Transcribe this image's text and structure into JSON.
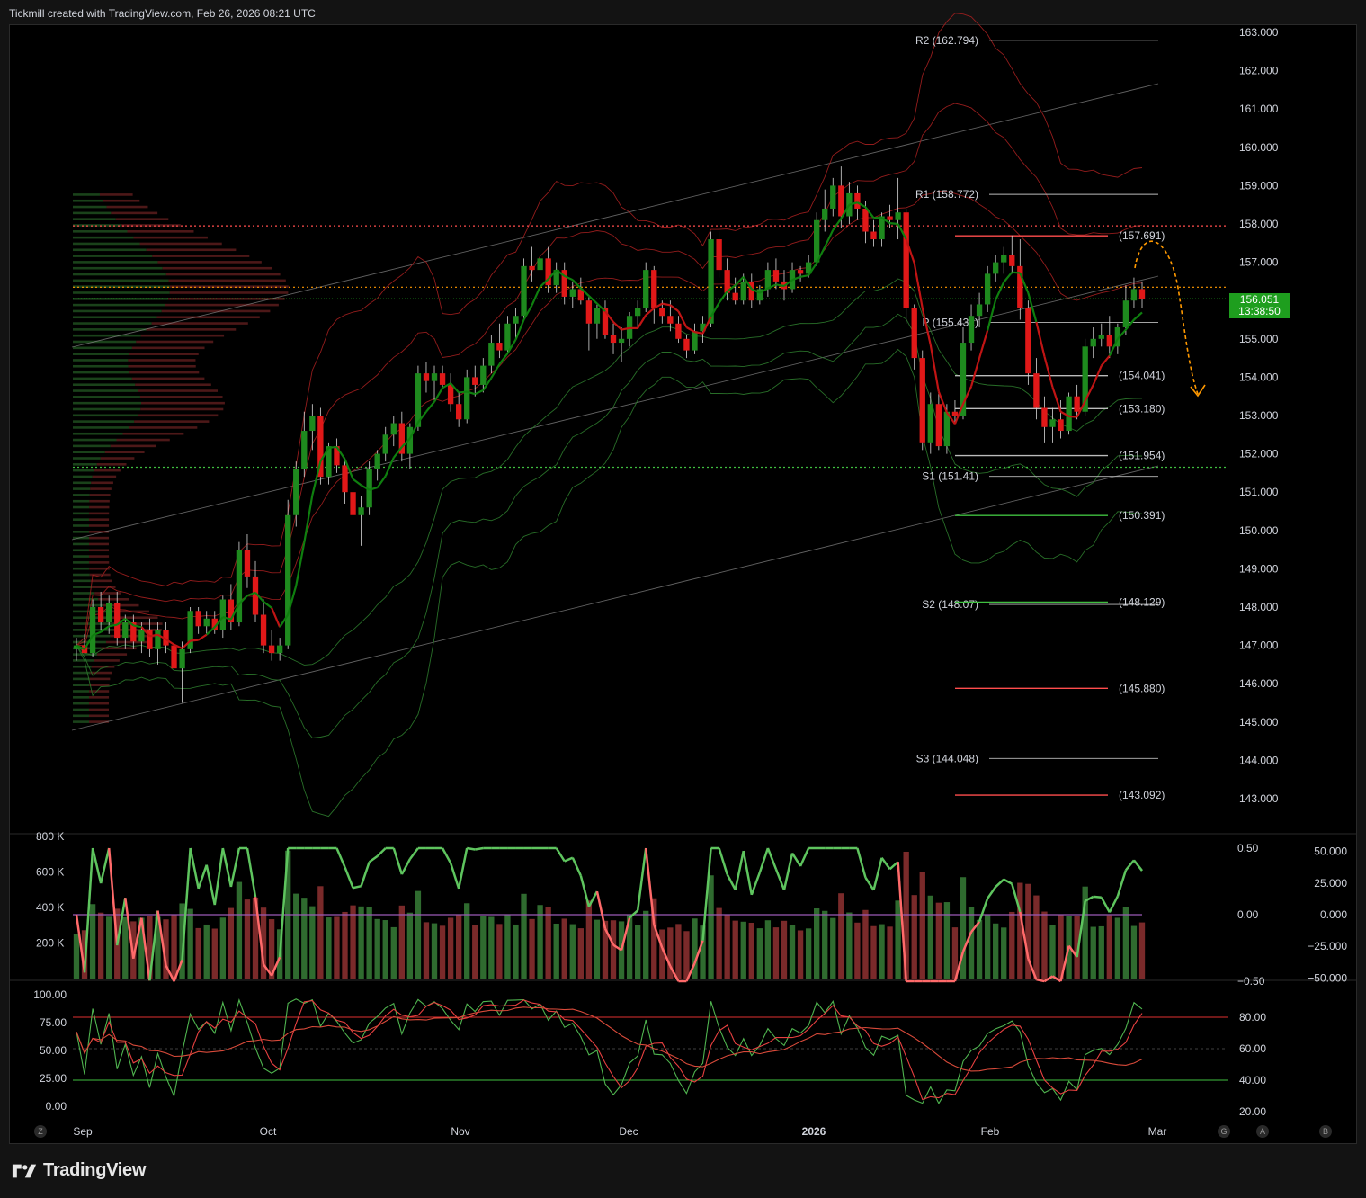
{
  "header": {
    "text": "Tickmill created with TradingView.com, Feb 26, 2026 08:21 UTC"
  },
  "footer": {
    "brand": "TradingView"
  },
  "price_box": {
    "price": "156.051",
    "countdown": "13:38:50"
  },
  "corner_buttons": {
    "z": "Z",
    "g": "G",
    "a": "A",
    "b": "B"
  },
  "colors": {
    "up": "#1e8a1e",
    "down": "#e01818",
    "bg": "#000000",
    "pivot": "#bbbbbb",
    "res": "#ff4d4d",
    "sup": "#3fbf3f",
    "orange": "#ff9900",
    "purple": "#9b59b6"
  },
  "chart_data": [
    {
      "type": "candlestick",
      "title": "",
      "ylim": [
        142.5,
        163.3
      ],
      "price_axis": [
        "163.000",
        "162.000",
        "161.000",
        "160.000",
        "159.000",
        "158.000",
        "157.000",
        "156.000",
        "155.000",
        "154.000",
        "153.000",
        "152.000",
        "151.000",
        "150.000",
        "149.000",
        "148.000",
        "147.000",
        "146.000",
        "145.000",
        "144.000",
        "143.000"
      ],
      "time_axis": [
        "Sep",
        "Oct",
        "Nov",
        "Dec",
        "2026",
        "Feb",
        "Mar"
      ],
      "candles": [
        [
          146.9,
          147.2,
          146.6,
          147.0
        ],
        [
          147.0,
          147.3,
          146.8,
          146.8
        ],
        [
          146.8,
          148.2,
          146.7,
          148.0
        ],
        [
          148.0,
          148.4,
          147.4,
          147.6
        ],
        [
          147.6,
          148.3,
          147.3,
          148.1
        ],
        [
          148.1,
          148.4,
          147.0,
          147.2
        ],
        [
          147.2,
          147.8,
          146.9,
          147.6
        ],
        [
          147.6,
          147.8,
          146.9,
          147.1
        ],
        [
          147.1,
          147.6,
          146.8,
          147.4
        ],
        [
          147.4,
          147.7,
          146.7,
          146.9
        ],
        [
          146.9,
          147.6,
          146.5,
          147.4
        ],
        [
          147.4,
          147.6,
          146.8,
          147.0
        ],
        [
          147.0,
          147.3,
          146.2,
          146.4
        ],
        [
          146.4,
          147.1,
          145.5,
          146.9
        ],
        [
          146.9,
          148.0,
          146.8,
          147.9
        ],
        [
          147.9,
          148.0,
          147.3,
          147.5
        ],
        [
          147.5,
          147.9,
          147.3,
          147.7
        ],
        [
          147.7,
          147.9,
          147.3,
          147.4
        ],
        [
          147.4,
          148.3,
          147.2,
          148.2
        ],
        [
          148.2,
          148.6,
          147.4,
          147.6
        ],
        [
          147.6,
          149.7,
          147.5,
          149.5
        ],
        [
          149.5,
          149.9,
          148.5,
          148.8
        ],
        [
          148.8,
          149.2,
          147.6,
          147.8
        ],
        [
          147.8,
          148.2,
          146.8,
          147.0
        ],
        [
          147.0,
          147.4,
          146.6,
          146.8
        ],
        [
          146.8,
          147.2,
          146.6,
          147.0
        ],
        [
          147.0,
          150.8,
          146.9,
          150.4
        ],
        [
          150.4,
          151.8,
          150.1,
          151.6
        ],
        [
          151.6,
          153.1,
          151.4,
          152.6
        ],
        [
          152.6,
          153.3,
          152.1,
          153.0
        ],
        [
          153.0,
          153.2,
          151.2,
          151.4
        ],
        [
          151.4,
          152.3,
          151.2,
          152.2
        ],
        [
          152.2,
          152.4,
          151.5,
          151.7
        ],
        [
          151.7,
          151.9,
          150.7,
          151.0
        ],
        [
          151.0,
          151.4,
          150.2,
          150.4
        ],
        [
          150.4,
          150.9,
          149.6,
          150.6
        ],
        [
          150.6,
          151.8,
          150.4,
          151.6
        ],
        [
          151.6,
          152.1,
          151.3,
          152.0
        ],
        [
          152.0,
          152.7,
          151.8,
          152.5
        ],
        [
          152.5,
          153.0,
          152.2,
          152.8
        ],
        [
          152.8,
          153.1,
          151.8,
          152.0
        ],
        [
          152.0,
          152.8,
          151.6,
          152.7
        ],
        [
          152.7,
          154.3,
          152.6,
          154.1
        ],
        [
          154.1,
          154.4,
          153.6,
          153.9
        ],
        [
          153.9,
          154.3,
          153.4,
          154.1
        ],
        [
          154.1,
          154.3,
          153.7,
          153.8
        ],
        [
          153.8,
          154.1,
          153.1,
          153.3
        ],
        [
          153.3,
          153.6,
          152.7,
          152.9
        ],
        [
          152.9,
          154.2,
          152.8,
          154.0
        ],
        [
          154.0,
          154.3,
          153.5,
          153.8
        ],
        [
          153.8,
          154.5,
          153.6,
          154.3
        ],
        [
          154.3,
          155.1,
          154.1,
          154.9
        ],
        [
          154.9,
          155.4,
          154.5,
          154.7
        ],
        [
          154.7,
          155.6,
          154.6,
          155.4
        ],
        [
          155.4,
          155.8,
          155.0,
          155.6
        ],
        [
          155.6,
          157.1,
          155.5,
          156.9
        ],
        [
          156.9,
          157.4,
          156.5,
          156.8
        ],
        [
          156.8,
          157.5,
          156.0,
          157.1
        ],
        [
          157.1,
          157.4,
          156.2,
          156.4
        ],
        [
          156.4,
          157.0,
          156.2,
          156.8
        ],
        [
          156.8,
          157.0,
          155.9,
          156.1
        ],
        [
          156.1,
          156.5,
          155.8,
          156.3
        ],
        [
          156.3,
          156.6,
          155.9,
          156.0
        ],
        [
          156.0,
          156.1,
          154.7,
          155.4
        ],
        [
          155.4,
          155.9,
          155.0,
          155.8
        ],
        [
          155.8,
          156.0,
          155.0,
          155.1
        ],
        [
          155.1,
          155.4,
          154.6,
          154.9
        ],
        [
          154.9,
          155.3,
          154.4,
          155.0
        ],
        [
          155.0,
          155.7,
          154.8,
          155.6
        ],
        [
          155.6,
          156.0,
          155.3,
          155.8
        ],
        [
          155.8,
          157.0,
          155.7,
          156.8
        ],
        [
          156.8,
          156.9,
          155.4,
          155.8
        ],
        [
          155.8,
          156.0,
          155.4,
          155.6
        ],
        [
          155.6,
          156.0,
          155.2,
          155.4
        ],
        [
          155.4,
          155.6,
          154.9,
          155.0
        ],
        [
          155.0,
          155.1,
          154.5,
          154.7
        ],
        [
          154.7,
          155.4,
          154.6,
          155.2
        ],
        [
          155.2,
          155.6,
          154.9,
          155.4
        ],
        [
          155.4,
          157.8,
          155.3,
          157.6
        ],
        [
          157.6,
          157.8,
          156.6,
          156.8
        ],
        [
          156.8,
          157.1,
          156.0,
          156.2
        ],
        [
          156.2,
          156.6,
          155.9,
          156.0
        ],
        [
          156.0,
          156.7,
          155.9,
          156.5
        ],
        [
          156.5,
          156.7,
          155.8,
          156.0
        ],
        [
          156.0,
          156.4,
          155.9,
          156.3
        ],
        [
          156.3,
          157.0,
          156.1,
          156.8
        ],
        [
          156.8,
          157.1,
          156.3,
          156.5
        ],
        [
          156.5,
          156.8,
          156.0,
          156.3
        ],
        [
          156.3,
          157.0,
          156.2,
          156.8
        ],
        [
          156.8,
          156.9,
          156.5,
          156.7
        ],
        [
          156.7,
          157.2,
          156.6,
          157.0
        ],
        [
          157.0,
          158.3,
          156.9,
          158.1
        ],
        [
          158.1,
          158.9,
          157.8,
          158.4
        ],
        [
          158.4,
          159.2,
          158.2,
          159.0
        ],
        [
          159.0,
          159.5,
          157.9,
          158.2
        ],
        [
          158.2,
          159.1,
          158.0,
          158.8
        ],
        [
          158.8,
          159.0,
          158.1,
          158.4
        ],
        [
          158.4,
          158.6,
          157.5,
          157.8
        ],
        [
          157.8,
          158.1,
          157.4,
          157.6
        ],
        [
          157.6,
          158.3,
          157.4,
          158.2
        ],
        [
          158.2,
          158.5,
          157.9,
          158.1
        ],
        [
          158.1,
          159.2,
          157.6,
          158.3
        ],
        [
          158.3,
          158.4,
          155.4,
          155.8
        ],
        [
          155.8,
          155.9,
          154.2,
          154.5
        ],
        [
          154.5,
          154.7,
          152.1,
          152.3
        ],
        [
          152.3,
          153.6,
          152.0,
          153.3
        ],
        [
          153.3,
          153.6,
          152.1,
          152.2
        ],
        [
          152.2,
          153.3,
          152.0,
          153.1
        ],
        [
          153.1,
          153.4,
          152.8,
          153.0
        ],
        [
          153.0,
          155.3,
          152.9,
          154.9
        ],
        [
          154.9,
          155.9,
          154.7,
          155.6
        ],
        [
          155.6,
          156.2,
          155.3,
          155.9
        ],
        [
          155.9,
          156.9,
          155.7,
          156.7
        ],
        [
          156.7,
          157.2,
          156.5,
          157.0
        ],
        [
          157.0,
          157.4,
          156.7,
          157.2
        ],
        [
          157.2,
          157.7,
          156.7,
          156.9
        ],
        [
          156.9,
          157.6,
          155.5,
          155.8
        ],
        [
          155.8,
          156.0,
          153.8,
          154.1
        ],
        [
          154.1,
          154.5,
          152.9,
          153.2
        ],
        [
          153.2,
          153.5,
          152.3,
          152.7
        ],
        [
          152.7,
          153.2,
          152.3,
          152.9
        ],
        [
          152.9,
          153.4,
          152.4,
          152.6
        ],
        [
          152.6,
          153.6,
          152.5,
          153.5
        ],
        [
          153.5,
          153.8,
          152.9,
          153.1
        ],
        [
          153.1,
          155.0,
          153.0,
          154.8
        ],
        [
          154.8,
          155.3,
          154.5,
          155.0
        ],
        [
          155.0,
          155.4,
          154.8,
          155.1
        ],
        [
          155.1,
          155.6,
          154.5,
          154.8
        ],
        [
          154.8,
          155.4,
          154.6,
          155.3
        ],
        [
          155.3,
          156.4,
          155.1,
          156.0
        ],
        [
          156.0,
          156.6,
          155.8,
          156.3
        ],
        [
          156.3,
          156.5,
          155.8,
          156.05
        ]
      ],
      "pivot_levels": [
        {
          "label": "R2 (162.794)",
          "value": 162.794
        },
        {
          "label": "R1 (158.772)",
          "value": 158.772
        },
        {
          "label": "P (155.432)",
          "value": 155.432
        },
        {
          "label": "S1 (151.41)",
          "value": 151.41
        },
        {
          "label": "S2 (148.07)",
          "value": 148.07
        },
        {
          "label": "S3 (144.048)",
          "value": 144.048
        }
      ],
      "fib_levels": [
        {
          "label": "(157.691)",
          "value": 157.691,
          "color": "res"
        },
        {
          "label": "(154.041)",
          "value": 154.041,
          "color": "pivot"
        },
        {
          "label": "(153.180)",
          "value": 153.18,
          "color": "pivot"
        },
        {
          "label": "(151.954)",
          "value": 151.954,
          "color": "pivot"
        },
        {
          "label": "(150.391)",
          "value": 150.391,
          "color": "sup"
        },
        {
          "label": "(148.129)",
          "value": 148.129,
          "color": "sup"
        },
        {
          "label": "(145.880)",
          "value": 145.88,
          "color": "res"
        },
        {
          "label": "(143.092)",
          "value": 143.092,
          "color": "res"
        }
      ],
      "hlines": [
        {
          "value": 157.95,
          "color": "res"
        },
        {
          "value": 156.35,
          "color": "orange"
        },
        {
          "value": 151.65,
          "color": "sup"
        }
      ]
    },
    {
      "type": "bar",
      "title": "",
      "volume_axis": [
        "800 K",
        "600 K",
        "400 K",
        "200 K"
      ],
      "osc_axis_left": [
        "0.50",
        "0.00",
        "−0.50"
      ],
      "osc_axis_right": [
        "50.000",
        "25.000",
        "0.000",
        "−25.000",
        "−50.000"
      ]
    },
    {
      "type": "line",
      "title": "",
      "left_axis": [
        "100.00",
        "75.00",
        "50.00",
        "25.00",
        "0.00"
      ],
      "right_axis": [
        "80.00",
        "60.00",
        "40.00",
        "20.00"
      ]
    }
  ]
}
